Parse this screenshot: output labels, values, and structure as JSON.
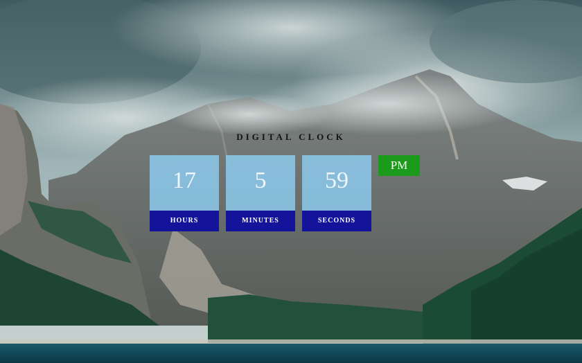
{
  "clock": {
    "title": "DIGITAL CLOCK",
    "hours": {
      "value": "17",
      "label": "HOURS"
    },
    "minutes": {
      "value": "5",
      "label": "MINUTES"
    },
    "seconds": {
      "value": "59",
      "label": "SECONDS"
    },
    "period": "PM"
  },
  "colors": {
    "box_fill": "#8cc8eb",
    "label_bar": "#14149a",
    "period_badge": "#1c9a1c",
    "title_text": "#141414",
    "lake": "#0f4a5a",
    "forest": "#1d4a35"
  },
  "background": {
    "icon": "mountain-lake-landscape"
  }
}
